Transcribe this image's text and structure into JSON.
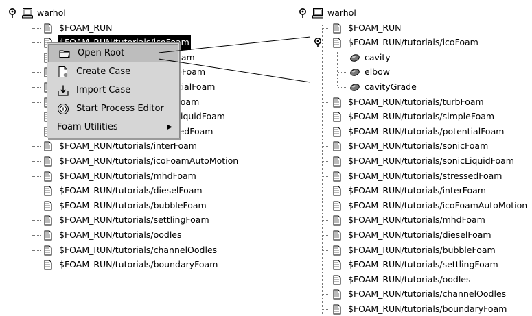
{
  "left_tree": {
    "root": "warhol",
    "items": [
      "$FOAM_RUN",
      "$FOAM_RUN/tutorials/icoFoam",
      "$FOAM_RUN/tutorials/turbFoam",
      "$FOAM_RUN/tutorials/simpleFoam",
      "$FOAM_RUN/tutorials/potentialFoam",
      "$FOAM_RUN/tutorials/sonicFoam",
      "$FOAM_RUN/tutorials/sonicLiquidFoam",
      "$FOAM_RUN/tutorials/stressedFoam",
      "$FOAM_RUN/tutorials/interFoam",
      "$FOAM_RUN/tutorials/icoFoamAutoMotion",
      "$FOAM_RUN/tutorials/mhdFoam",
      "$FOAM_RUN/tutorials/dieselFoam",
      "$FOAM_RUN/tutorials/bubbleFoam",
      "$FOAM_RUN/tutorials/settlingFoam",
      "$FOAM_RUN/tutorials/oodles",
      "$FOAM_RUN/tutorials/channelOodles",
      "$FOAM_RUN/tutorials/boundaryFoam"
    ]
  },
  "context_menu": {
    "open_root": "Open Root",
    "create_case": "Create Case",
    "import_case": "Import Case",
    "start_process_editor": "Start Process Editor",
    "foam_utilities": "Foam Utilities"
  },
  "right_tree": {
    "root": "warhol",
    "run": "$FOAM_RUN",
    "expanded": "$FOAM_RUN/tutorials/icoFoam",
    "cases": [
      "cavity",
      "elbow",
      "cavityGrade"
    ],
    "items": [
      "$FOAM_RUN/tutorials/turbFoam",
      "$FOAM_RUN/tutorials/simpleFoam",
      "$FOAM_RUN/tutorials/potentialFoam",
      "$FOAM_RUN/tutorials/sonicFoam",
      "$FOAM_RUN/tutorials/sonicLiquidFoam",
      "$FOAM_RUN/tutorials/stressedFoam",
      "$FOAM_RUN/tutorials/interFoam",
      "$FOAM_RUN/tutorials/icoFoamAutoMotion",
      "$FOAM_RUN/tutorials/mhdFoam",
      "$FOAM_RUN/tutorials/dieselFoam",
      "$FOAM_RUN/tutorials/bubbleFoam",
      "$FOAM_RUN/tutorials/settlingFoam",
      "$FOAM_RUN/tutorials/oodles",
      "$FOAM_RUN/tutorials/channelOodles",
      "$FOAM_RUN/tutorials/boundaryFoam"
    ]
  }
}
